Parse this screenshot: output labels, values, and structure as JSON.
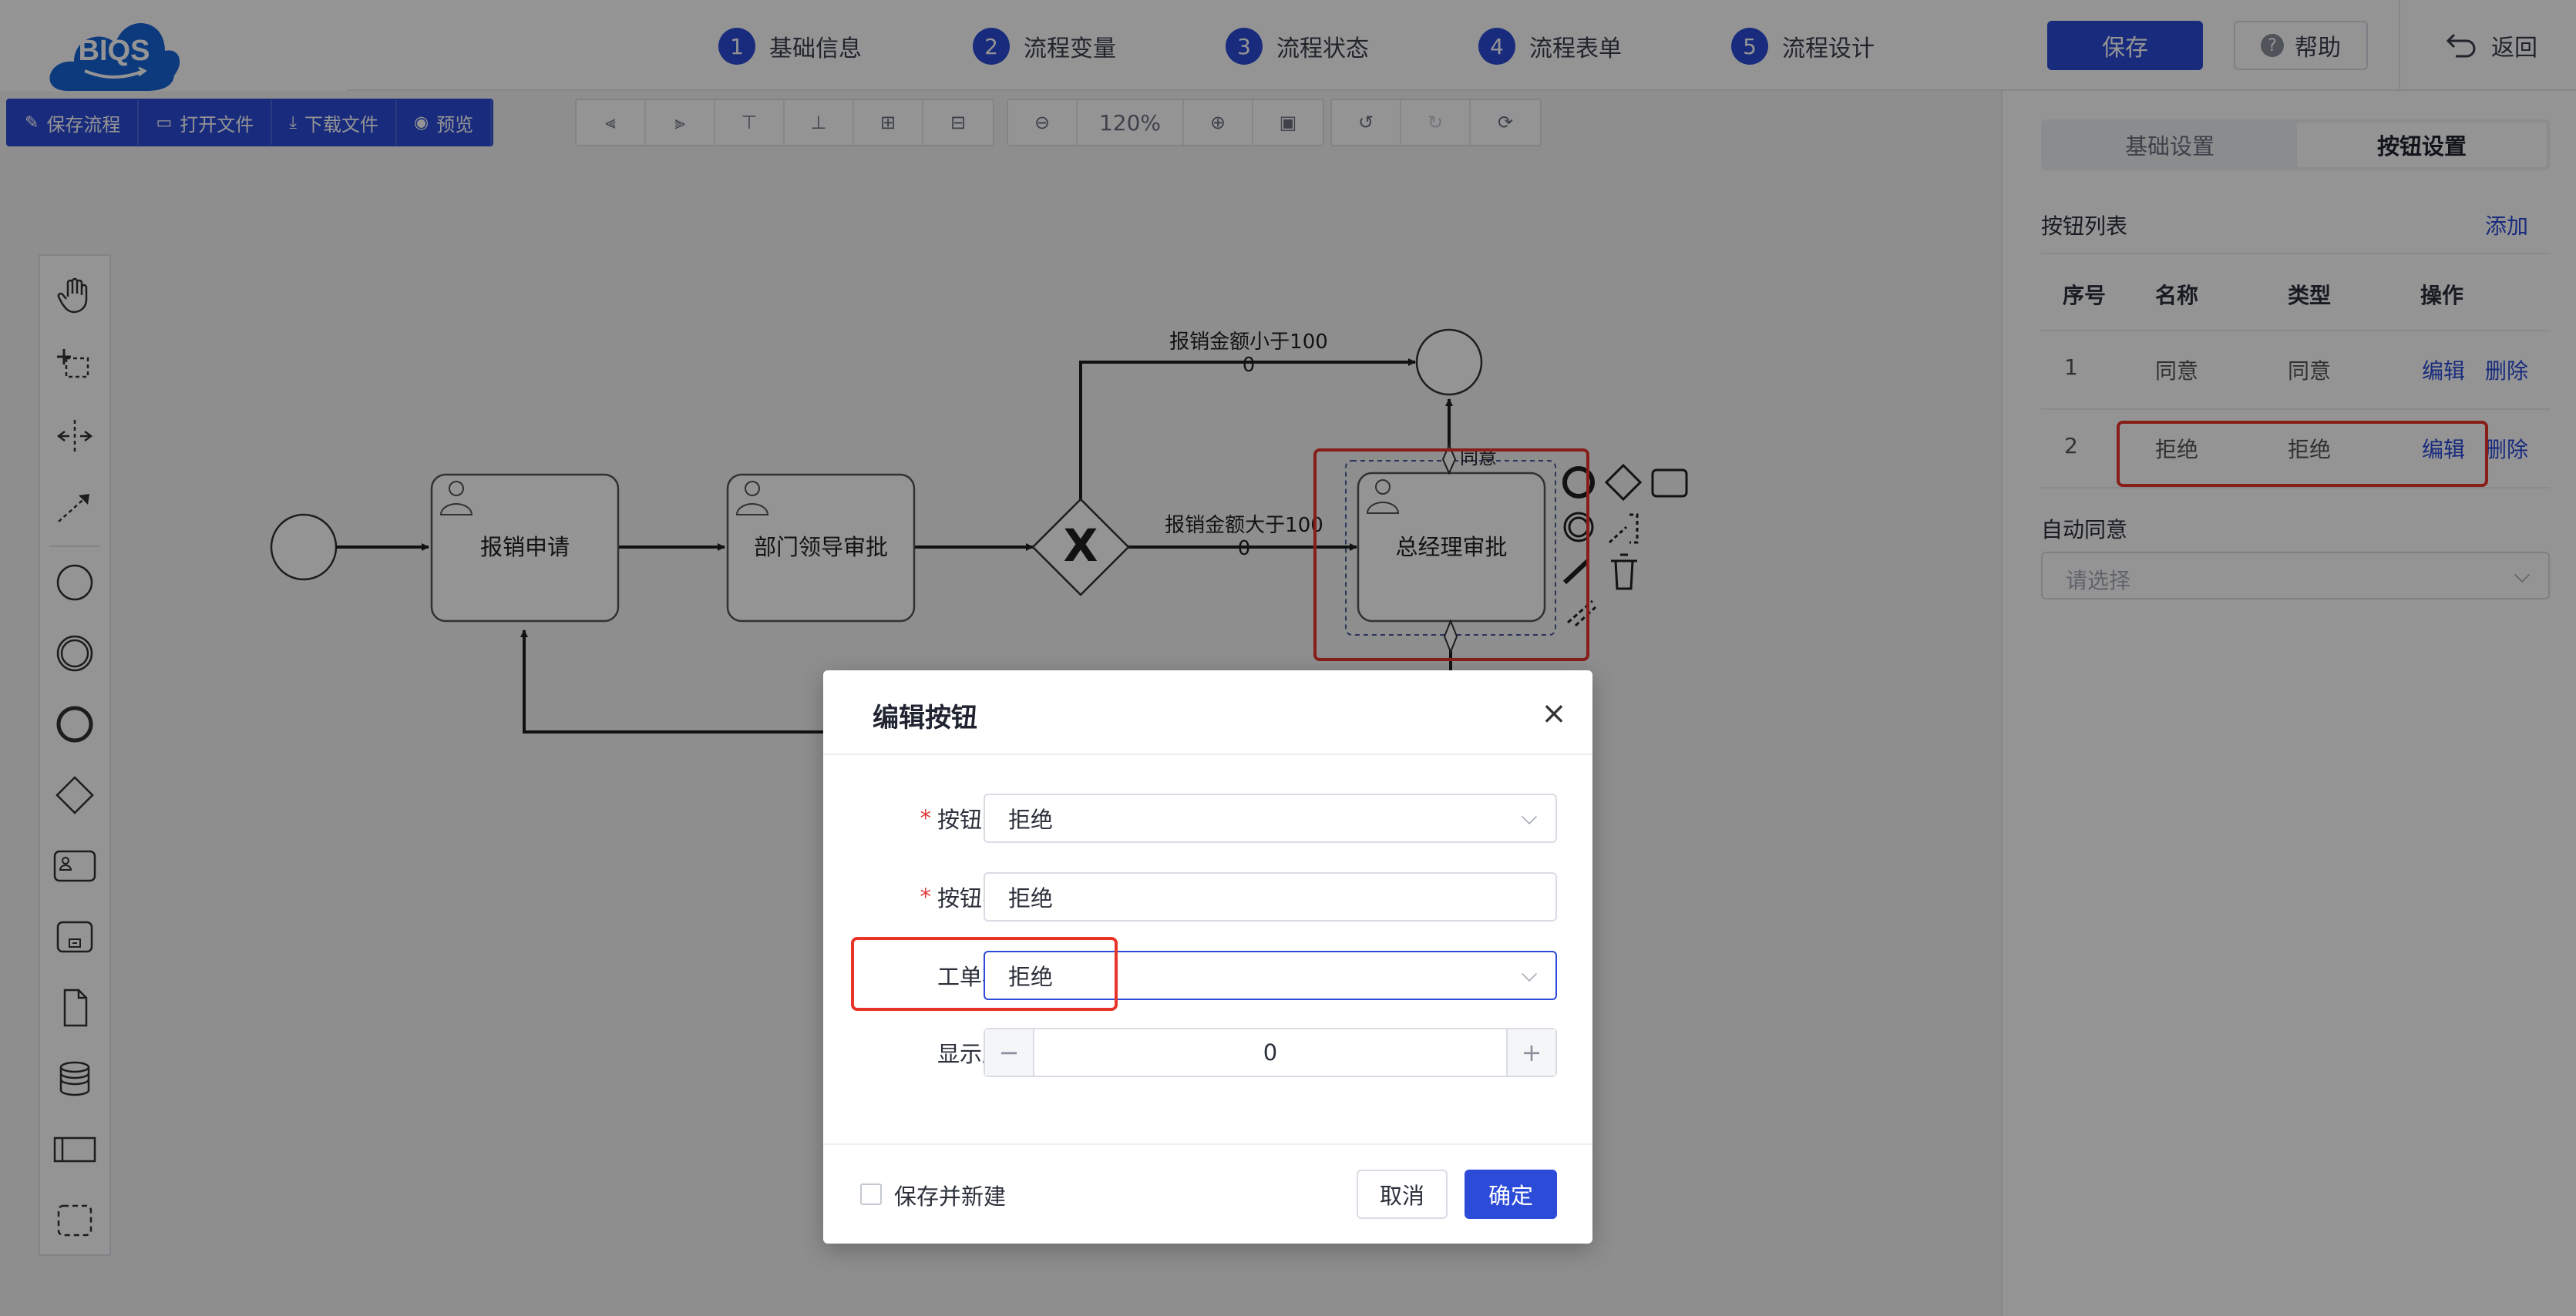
{
  "header": {
    "steps": [
      {
        "num": "1",
        "label": "基础信息"
      },
      {
        "num": "2",
        "label": "流程变量"
      },
      {
        "num": "3",
        "label": "流程状态"
      },
      {
        "num": "4",
        "label": "流程表单"
      },
      {
        "num": "5",
        "label": "流程设计"
      }
    ],
    "save_label": "保存",
    "help_label": "帮助",
    "back_label": "返回",
    "logo_text": "BIQS"
  },
  "toolbar": {
    "save_flow": "保存流程",
    "open_file": "打开文件",
    "download_file": "下载文件",
    "preview": "预览",
    "zoom": "120%"
  },
  "diagram": {
    "tasks": [
      "报销申请",
      "部门领导审批",
      "总经理审批"
    ],
    "flow_labels": [
      {
        "line1": "报销金额小于100",
        "line2": "0"
      },
      {
        "line1": "报销金额大于100",
        "line2": "0"
      }
    ],
    "agree_label": "同意",
    "gateway_symbol": "X"
  },
  "right_panel": {
    "tabs": [
      "基础设置",
      "按钮设置"
    ],
    "list_title": "按钮列表",
    "add_label": "添加",
    "columns": [
      "序号",
      "名称",
      "类型",
      "操作"
    ],
    "rows": [
      {
        "no": "1",
        "name": "同意",
        "type": "同意",
        "edit": "编辑",
        "delete": "删除"
      },
      {
        "no": "2",
        "name": "拒绝",
        "type": "拒绝",
        "edit": "编辑",
        "delete": "删除"
      }
    ],
    "auto_agree_label": "自动同意",
    "auto_agree_placeholder": "请选择"
  },
  "modal": {
    "title": "编辑按钮",
    "fields": {
      "button_type_label": "按钮类型",
      "button_type_value": "拒绝",
      "button_name_label": "按钮名称",
      "button_name_value": "拒绝",
      "order_state_label": "工单状态",
      "order_state_value": "拒绝",
      "display_order_label": "显示顺序",
      "display_order_value": "0"
    },
    "save_new_label": "保存并新建",
    "cancel_label": "取消",
    "ok_label": "确定"
  },
  "colors": {
    "accent": "#2b4bd8",
    "highlight": "#e8342a",
    "required": "#e23b3b"
  }
}
